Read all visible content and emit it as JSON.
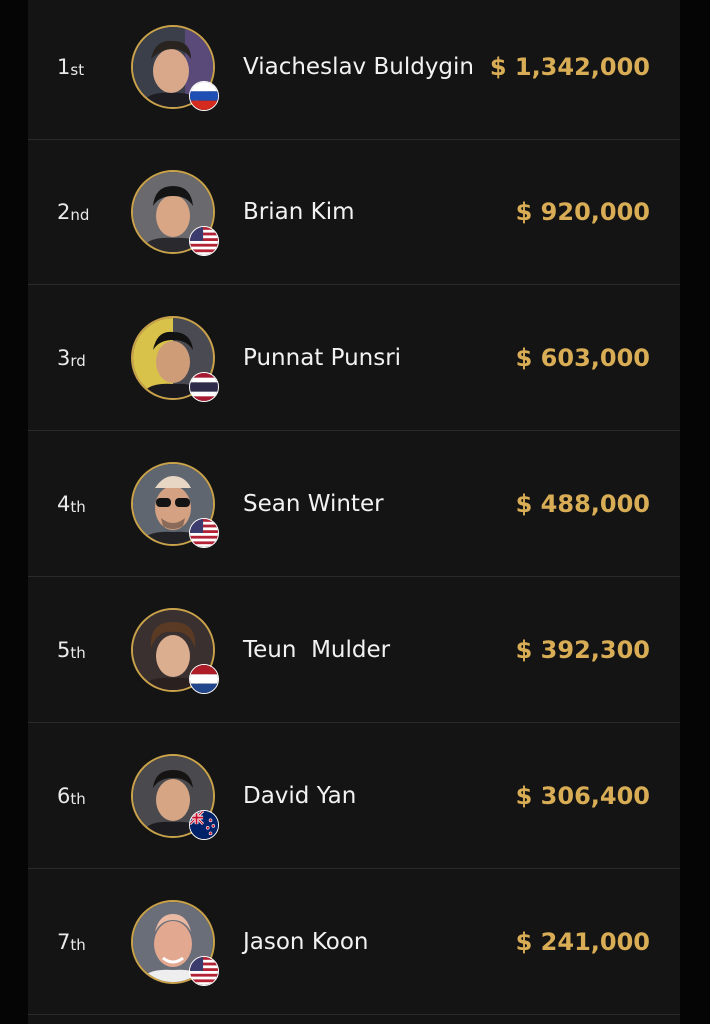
{
  "colors": {
    "background": "#050505",
    "panel": "#141414",
    "divider": "#2a2a2a",
    "gold_accent": "#c9a24a",
    "prize_text": "#d9ad55",
    "name_text": "#f2f2f2"
  },
  "leaderboard": [
    {
      "rank_number": "1",
      "rank_suffix": "st",
      "name": "Viacheslav Buldygin",
      "prize": "$ 1,342,000",
      "flag": "russia-flag-icon",
      "country": "Russia"
    },
    {
      "rank_number": "2",
      "rank_suffix": "nd",
      "name": "Brian Kim",
      "prize": "$ 920,000",
      "flag": "usa-flag-icon",
      "country": "USA"
    },
    {
      "rank_number": "3",
      "rank_suffix": "rd",
      "name": "Punnat Punsri",
      "prize": "$ 603,000",
      "flag": "thailand-flag-icon",
      "country": "Thailand"
    },
    {
      "rank_number": "4",
      "rank_suffix": "th",
      "name": "Sean Winter",
      "prize": "$ 488,000",
      "flag": "usa-flag-icon",
      "country": "USA"
    },
    {
      "rank_number": "5",
      "rank_suffix": "th",
      "name": "Teun  Mulder",
      "prize": "$ 392,300",
      "flag": "netherlands-flag-icon",
      "country": "Netherlands"
    },
    {
      "rank_number": "6",
      "rank_suffix": "th",
      "name": "David Yan",
      "prize": "$ 306,400",
      "flag": "new-zealand-flag-icon",
      "country": "New Zealand"
    },
    {
      "rank_number": "7",
      "rank_suffix": "th",
      "name": "Jason Koon",
      "prize": "$ 241,000",
      "flag": "usa-flag-icon",
      "country": "USA"
    }
  ]
}
